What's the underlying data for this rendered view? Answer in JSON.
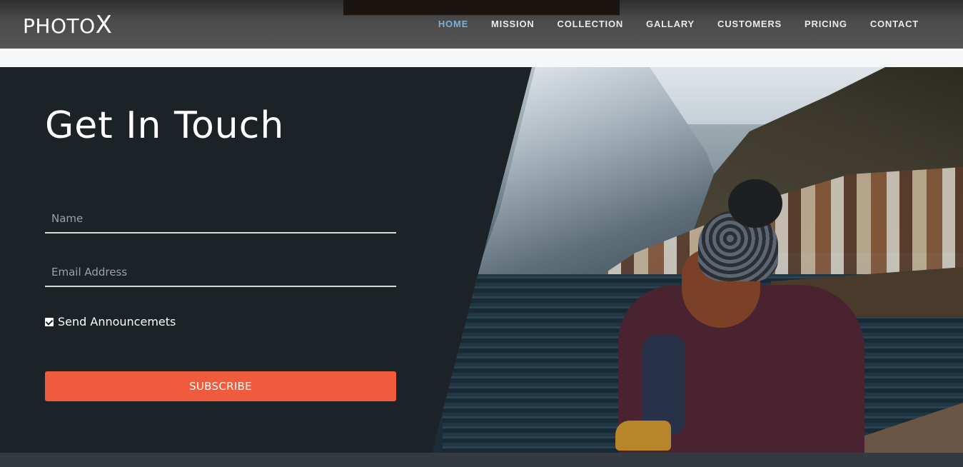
{
  "brand": {
    "prefix": "PHOTO",
    "suffix": "X"
  },
  "nav": {
    "items": [
      "HOME",
      "MISSION",
      "COLLECTION",
      "GALLARY",
      "CUSTOMERS",
      "PRICING",
      "CONTACT"
    ],
    "active": "HOME"
  },
  "contact": {
    "title": "Get In Touch",
    "name_placeholder": "Name",
    "email_placeholder": "Email Address",
    "checkbox_label": "Send Announcemets",
    "checkbox_checked": true,
    "subscribe_label": "SUBSCRIBE"
  },
  "colors": {
    "accent": "#f05b3d",
    "nav_active": "#7fb0d8",
    "hero_dark": "#1c2326",
    "footer": "#343a40"
  }
}
